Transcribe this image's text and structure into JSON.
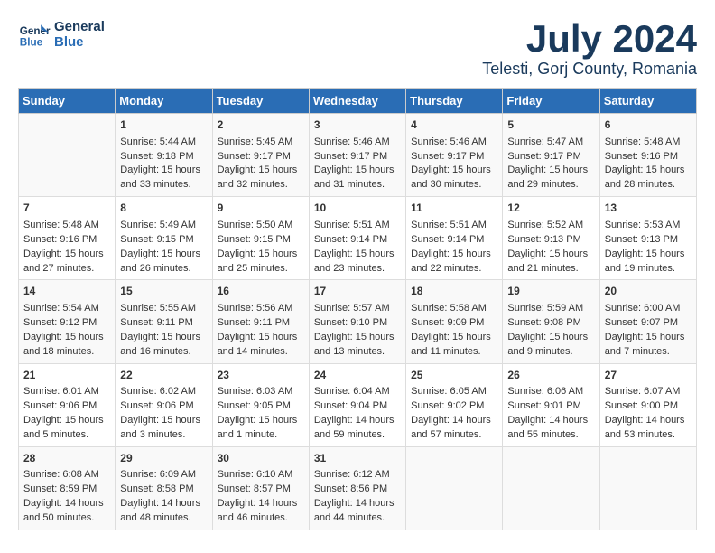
{
  "header": {
    "logo_line1": "General",
    "logo_line2": "Blue",
    "month": "July 2024",
    "location": "Telesti, Gorj County, Romania"
  },
  "days_of_week": [
    "Sunday",
    "Monday",
    "Tuesday",
    "Wednesday",
    "Thursday",
    "Friday",
    "Saturday"
  ],
  "weeks": [
    [
      {
        "day": "",
        "data": ""
      },
      {
        "day": "1",
        "sunrise": "Sunrise: 5:44 AM",
        "sunset": "Sunset: 9:18 PM",
        "daylight": "Daylight: 15 hours and 33 minutes."
      },
      {
        "day": "2",
        "sunrise": "Sunrise: 5:45 AM",
        "sunset": "Sunset: 9:17 PM",
        "daylight": "Daylight: 15 hours and 32 minutes."
      },
      {
        "day": "3",
        "sunrise": "Sunrise: 5:46 AM",
        "sunset": "Sunset: 9:17 PM",
        "daylight": "Daylight: 15 hours and 31 minutes."
      },
      {
        "day": "4",
        "sunrise": "Sunrise: 5:46 AM",
        "sunset": "Sunset: 9:17 PM",
        "daylight": "Daylight: 15 hours and 30 minutes."
      },
      {
        "day": "5",
        "sunrise": "Sunrise: 5:47 AM",
        "sunset": "Sunset: 9:17 PM",
        "daylight": "Daylight: 15 hours and 29 minutes."
      },
      {
        "day": "6",
        "sunrise": "Sunrise: 5:48 AM",
        "sunset": "Sunset: 9:16 PM",
        "daylight": "Daylight: 15 hours and 28 minutes."
      }
    ],
    [
      {
        "day": "7",
        "sunrise": "Sunrise: 5:48 AM",
        "sunset": "Sunset: 9:16 PM",
        "daylight": "Daylight: 15 hours and 27 minutes."
      },
      {
        "day": "8",
        "sunrise": "Sunrise: 5:49 AM",
        "sunset": "Sunset: 9:15 PM",
        "daylight": "Daylight: 15 hours and 26 minutes."
      },
      {
        "day": "9",
        "sunrise": "Sunrise: 5:50 AM",
        "sunset": "Sunset: 9:15 PM",
        "daylight": "Daylight: 15 hours and 25 minutes."
      },
      {
        "day": "10",
        "sunrise": "Sunrise: 5:51 AM",
        "sunset": "Sunset: 9:14 PM",
        "daylight": "Daylight: 15 hours and 23 minutes."
      },
      {
        "day": "11",
        "sunrise": "Sunrise: 5:51 AM",
        "sunset": "Sunset: 9:14 PM",
        "daylight": "Daylight: 15 hours and 22 minutes."
      },
      {
        "day": "12",
        "sunrise": "Sunrise: 5:52 AM",
        "sunset": "Sunset: 9:13 PM",
        "daylight": "Daylight: 15 hours and 21 minutes."
      },
      {
        "day": "13",
        "sunrise": "Sunrise: 5:53 AM",
        "sunset": "Sunset: 9:13 PM",
        "daylight": "Daylight: 15 hours and 19 minutes."
      }
    ],
    [
      {
        "day": "14",
        "sunrise": "Sunrise: 5:54 AM",
        "sunset": "Sunset: 9:12 PM",
        "daylight": "Daylight: 15 hours and 18 minutes."
      },
      {
        "day": "15",
        "sunrise": "Sunrise: 5:55 AM",
        "sunset": "Sunset: 9:11 PM",
        "daylight": "Daylight: 15 hours and 16 minutes."
      },
      {
        "day": "16",
        "sunrise": "Sunrise: 5:56 AM",
        "sunset": "Sunset: 9:11 PM",
        "daylight": "Daylight: 15 hours and 14 minutes."
      },
      {
        "day": "17",
        "sunrise": "Sunrise: 5:57 AM",
        "sunset": "Sunset: 9:10 PM",
        "daylight": "Daylight: 15 hours and 13 minutes."
      },
      {
        "day": "18",
        "sunrise": "Sunrise: 5:58 AM",
        "sunset": "Sunset: 9:09 PM",
        "daylight": "Daylight: 15 hours and 11 minutes."
      },
      {
        "day": "19",
        "sunrise": "Sunrise: 5:59 AM",
        "sunset": "Sunset: 9:08 PM",
        "daylight": "Daylight: 15 hours and 9 minutes."
      },
      {
        "day": "20",
        "sunrise": "Sunrise: 6:00 AM",
        "sunset": "Sunset: 9:07 PM",
        "daylight": "Daylight: 15 hours and 7 minutes."
      }
    ],
    [
      {
        "day": "21",
        "sunrise": "Sunrise: 6:01 AM",
        "sunset": "Sunset: 9:06 PM",
        "daylight": "Daylight: 15 hours and 5 minutes."
      },
      {
        "day": "22",
        "sunrise": "Sunrise: 6:02 AM",
        "sunset": "Sunset: 9:06 PM",
        "daylight": "Daylight: 15 hours and 3 minutes."
      },
      {
        "day": "23",
        "sunrise": "Sunrise: 6:03 AM",
        "sunset": "Sunset: 9:05 PM",
        "daylight": "Daylight: 15 hours and 1 minute."
      },
      {
        "day": "24",
        "sunrise": "Sunrise: 6:04 AM",
        "sunset": "Sunset: 9:04 PM",
        "daylight": "Daylight: 14 hours and 59 minutes."
      },
      {
        "day": "25",
        "sunrise": "Sunrise: 6:05 AM",
        "sunset": "Sunset: 9:02 PM",
        "daylight": "Daylight: 14 hours and 57 minutes."
      },
      {
        "day": "26",
        "sunrise": "Sunrise: 6:06 AM",
        "sunset": "Sunset: 9:01 PM",
        "daylight": "Daylight: 14 hours and 55 minutes."
      },
      {
        "day": "27",
        "sunrise": "Sunrise: 6:07 AM",
        "sunset": "Sunset: 9:00 PM",
        "daylight": "Daylight: 14 hours and 53 minutes."
      }
    ],
    [
      {
        "day": "28",
        "sunrise": "Sunrise: 6:08 AM",
        "sunset": "Sunset: 8:59 PM",
        "daylight": "Daylight: 14 hours and 50 minutes."
      },
      {
        "day": "29",
        "sunrise": "Sunrise: 6:09 AM",
        "sunset": "Sunset: 8:58 PM",
        "daylight": "Daylight: 14 hours and 48 minutes."
      },
      {
        "day": "30",
        "sunrise": "Sunrise: 6:10 AM",
        "sunset": "Sunset: 8:57 PM",
        "daylight": "Daylight: 14 hours and 46 minutes."
      },
      {
        "day": "31",
        "sunrise": "Sunrise: 6:12 AM",
        "sunset": "Sunset: 8:56 PM",
        "daylight": "Daylight: 14 hours and 44 minutes."
      },
      {
        "day": "",
        "data": ""
      },
      {
        "day": "",
        "data": ""
      },
      {
        "day": "",
        "data": ""
      }
    ]
  ]
}
